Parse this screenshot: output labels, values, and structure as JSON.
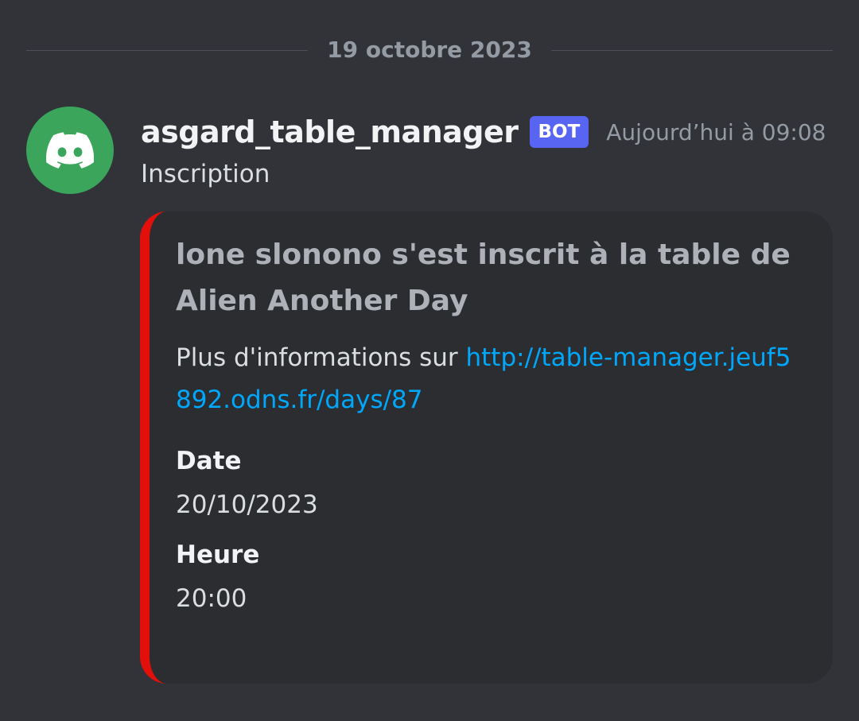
{
  "divider": {
    "date": "19 octobre 2023"
  },
  "message": {
    "username": "asgard_table_manager",
    "bot_tag": "BOT",
    "timestamp": "Aujourd’hui à 09:08",
    "content": "Inscription",
    "avatar_icon": "discord-logo-icon",
    "avatar_color": "#3ba55c"
  },
  "embed": {
    "accent_color": "#e30f0b",
    "title": "lone slonono s'est inscrit à la table de Alien Another Day",
    "description_prefix": "Plus d'informations sur ",
    "link_text": "http://table-manager.jeuf5892.odns.fr/days/87",
    "fields": [
      {
        "name": "Date",
        "value": "20/10/2023"
      },
      {
        "name": "Heure",
        "value": "20:00"
      }
    ]
  }
}
